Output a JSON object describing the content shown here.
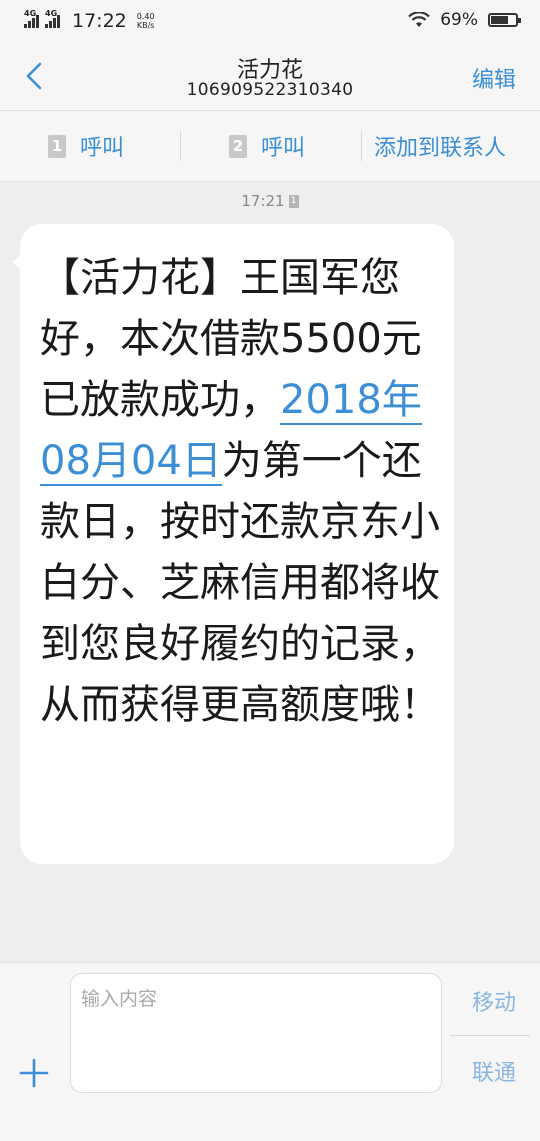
{
  "status_bar": {
    "sim1_label": "4G",
    "sim2_label": "4G",
    "time": "17:22",
    "speed_value": "0.40",
    "speed_unit": "KB/s",
    "battery_percent": "69%",
    "battery_level": 0.69
  },
  "header": {
    "title": "活力花",
    "number": "106909522310340",
    "edit_label": "编辑"
  },
  "actions": {
    "call1_sim": "1",
    "call1_label": "呼叫",
    "call2_sim": "2",
    "call2_label": "呼叫",
    "add_contact_label": "添加到联系人"
  },
  "message": {
    "time": "17:21",
    "sim": "1",
    "text_before": "【活力花】王国军您好，本次借款5500元已放款成功，",
    "link_text": "2018年08月04日",
    "text_after": "为第一个还款日，按时还款京东小白分、芝麻信用都将收到您良好履约的记录，从而获得更高额度哦！"
  },
  "composer": {
    "placeholder": "输入内容",
    "send1_label": "移动",
    "send2_label": "联通"
  },
  "colors": {
    "accent": "#3c8fd6",
    "send_disabled": "#8ab6e0",
    "background": "#eeeeee"
  }
}
